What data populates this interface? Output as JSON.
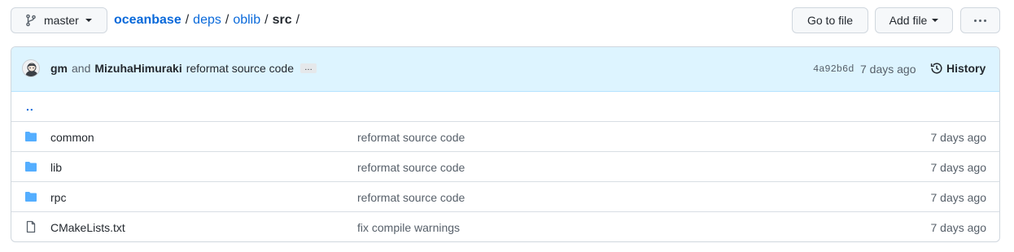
{
  "colors": {
    "link": "#0969da",
    "folder": "#54aeff",
    "commit_bar": "#ddf4ff",
    "border": "#d0d7de"
  },
  "branch": {
    "icon": "git-branch-icon",
    "label": "master"
  },
  "breadcrumb": {
    "root": "oceanbase",
    "parts": [
      "deps",
      "oblib"
    ],
    "current": "src",
    "separator": "/"
  },
  "actions": {
    "go_to_file": "Go to file",
    "add_file": "Add file",
    "more": "more-options-icon"
  },
  "commit": {
    "avatar": "user-avatar",
    "author1": "gm",
    "and": "and",
    "author2": "MizuhaHimuraki",
    "message": "reformat source code",
    "ellipsis": "…",
    "sha": "4a92b6d",
    "time": "7 days ago",
    "history_label": "History"
  },
  "parent_dir": "..",
  "files": [
    {
      "type": "folder",
      "name": "common",
      "message": "reformat source code",
      "age": "7 days ago"
    },
    {
      "type": "folder",
      "name": "lib",
      "message": "reformat source code",
      "age": "7 days ago"
    },
    {
      "type": "folder",
      "name": "rpc",
      "message": "reformat source code",
      "age": "7 days ago"
    },
    {
      "type": "file",
      "name": "CMakeLists.txt",
      "message": "fix compile warnings",
      "age": "7 days ago"
    }
  ]
}
